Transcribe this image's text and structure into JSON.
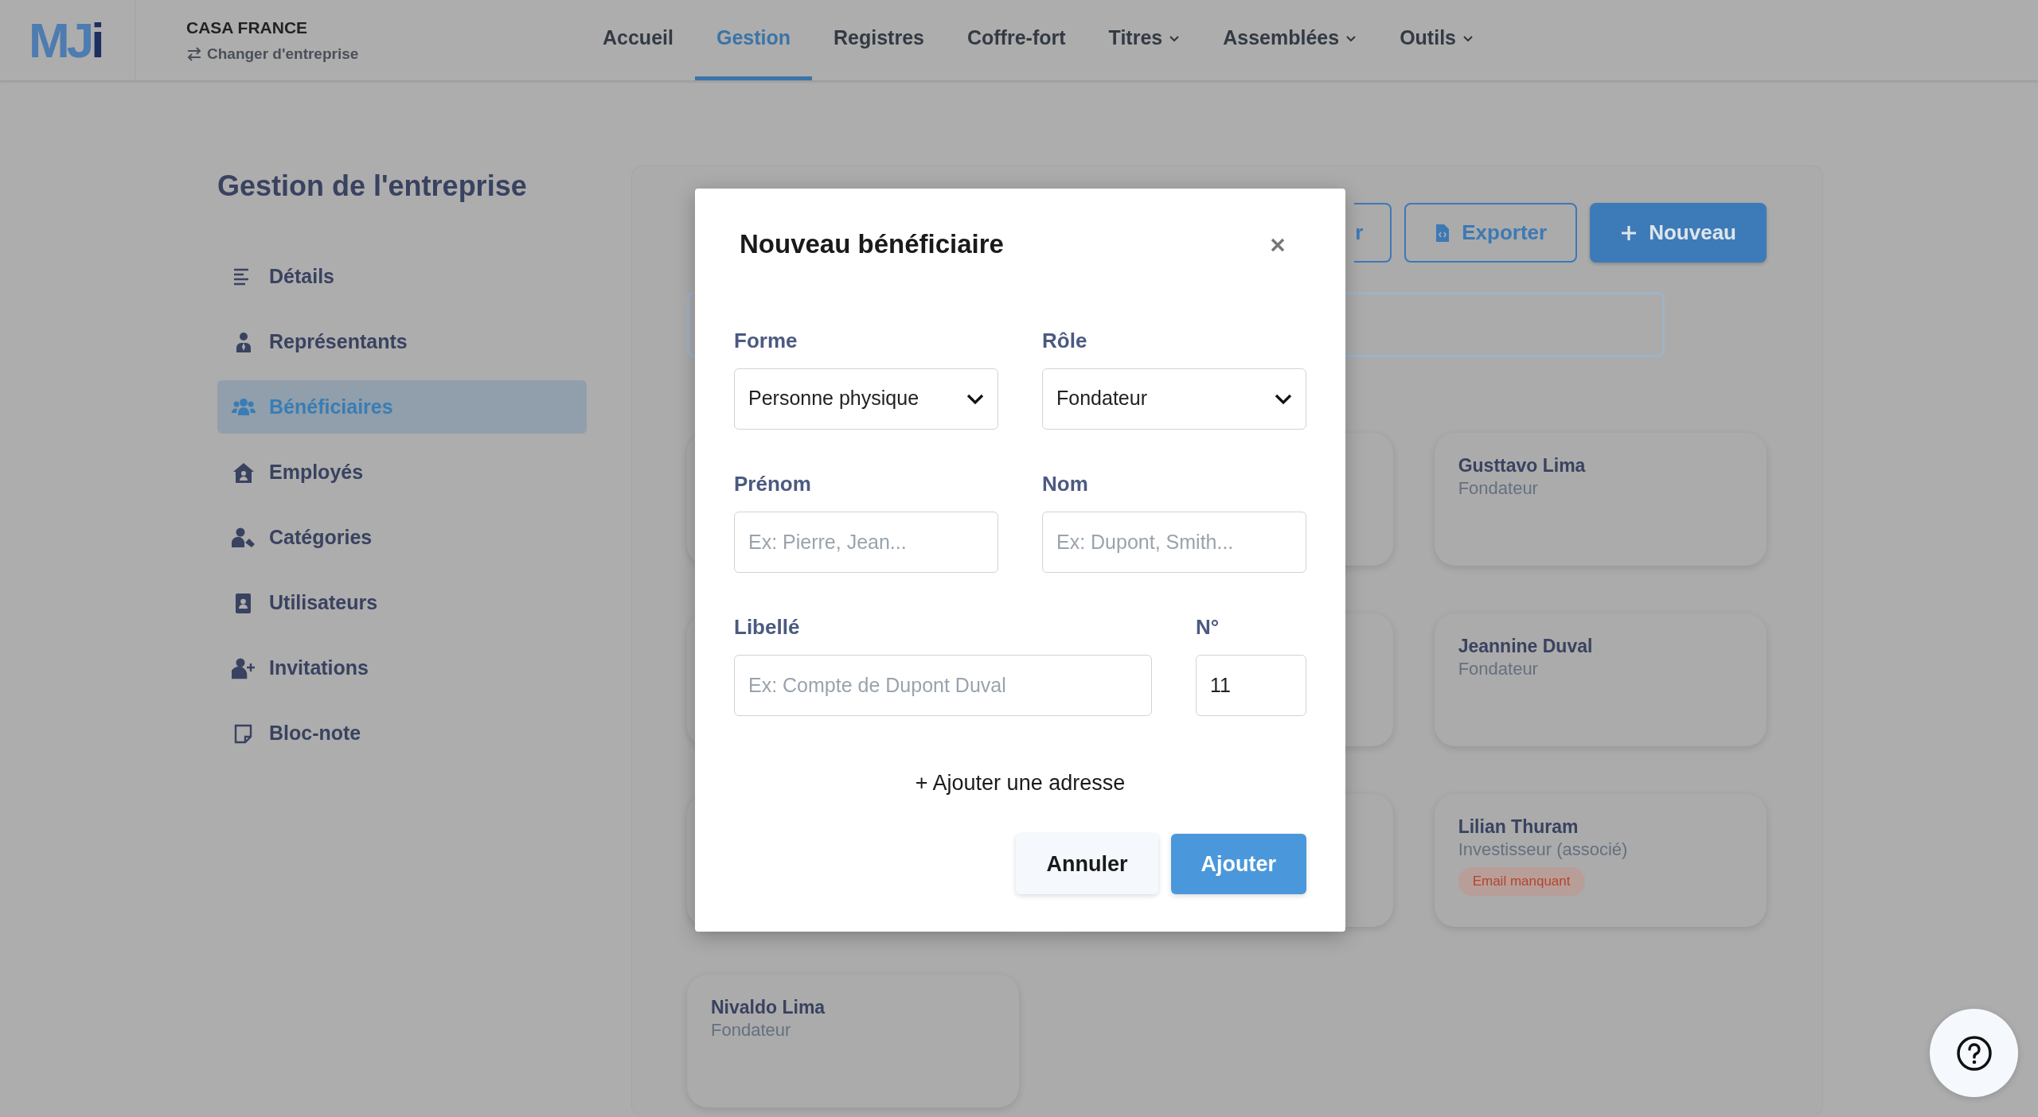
{
  "header": {
    "logo": "MJi",
    "company": "CASA FRANCE",
    "switch_link": "Changer d'entreprise"
  },
  "nav": [
    {
      "label": "Accueil",
      "selected": false,
      "menu": false
    },
    {
      "label": "Gestion",
      "selected": true,
      "menu": false
    },
    {
      "label": "Registres",
      "selected": false,
      "menu": false
    },
    {
      "label": "Coffre-fort",
      "selected": false,
      "menu": false
    },
    {
      "label": "Titres",
      "selected": false,
      "menu": true
    },
    {
      "label": "Assemblées",
      "selected": false,
      "menu": true
    },
    {
      "label": "Outils",
      "selected": false,
      "menu": true
    }
  ],
  "sidebar": {
    "title": "Gestion de l'entreprise",
    "items": [
      {
        "label": "Détails",
        "selected": false
      },
      {
        "label": "Représentants",
        "selected": false
      },
      {
        "label": "Bénéficiaires",
        "selected": true
      },
      {
        "label": "Employés",
        "selected": false
      },
      {
        "label": "Catégories",
        "selected": false
      },
      {
        "label": "Utilisateurs",
        "selected": false
      },
      {
        "label": "Invitations",
        "selected": false
      },
      {
        "label": "Bloc-note",
        "selected": false
      }
    ]
  },
  "panel": {
    "buttons": [
      {
        "label": "r",
        "kind": "outline"
      },
      {
        "label": "Exporter",
        "kind": "file"
      },
      {
        "label": "Nouveau",
        "kind": "primary"
      }
    ],
    "cards": [
      {
        "kind": "covered"
      },
      {
        "kind": "covered"
      },
      {
        "kind": "person",
        "name": "Gusttavo Lima",
        "role": "Fondateur"
      },
      {
        "kind": "covered"
      },
      {
        "kind": "covered"
      },
      {
        "kind": "person",
        "name": "Jeannine Duval",
        "role": "Fondateur"
      },
      {
        "kind": "covered"
      },
      {
        "kind": "covered"
      },
      {
        "kind": "person",
        "name": "Lilian Thuram",
        "role": "Investisseur (associé)",
        "badge": "Email manquant"
      },
      {
        "kind": "person",
        "name": "Nivaldo Lima",
        "role": "Fondateur"
      }
    ]
  },
  "modal": {
    "title": "Nouveau bénéficiaire",
    "rows": [
      [
        {
          "label": "Forme",
          "kind": "select",
          "value": "Personne physique"
        },
        {
          "label": "Rôle",
          "kind": "select",
          "value": "Fondateur"
        }
      ],
      [
        {
          "label": "Prénom",
          "kind": "text",
          "placeholder": "Ex: Pierre, Jean..."
        },
        {
          "label": "Nom",
          "kind": "text",
          "placeholder": "Ex: Dupont, Smith..."
        }
      ],
      [
        {
          "label": "Libellé",
          "kind": "text",
          "placeholder": "Ex: Compte de Dupont Duval"
        },
        {
          "label": "N°",
          "kind": "number",
          "value": "11"
        }
      ]
    ],
    "add_link": "+ Ajouter une adresse",
    "buttons": [
      {
        "label": "Annuler",
        "kind": "secondary"
      },
      {
        "label": "Ajouter",
        "kind": "primary"
      }
    ]
  }
}
